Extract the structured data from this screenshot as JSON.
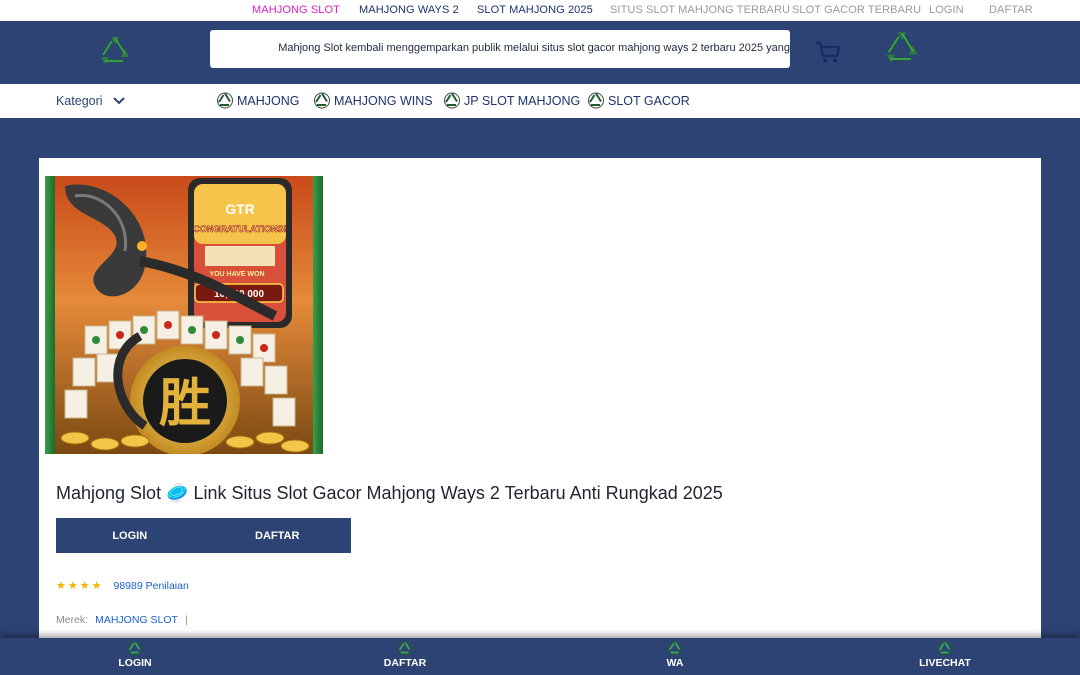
{
  "topbar": {
    "links": [
      {
        "label": "MAHJONG SLOT",
        "color": "#e020c8"
      },
      {
        "label": "MAHJONG WAYS 2",
        "color": "#1e3370"
      },
      {
        "label": "SLOT MAHJONG 2025",
        "color": "#1e3370"
      },
      {
        "label": "SITUS SLOT MAHJONG TERBARU",
        "color": "#9a9a9a"
      },
      {
        "label": "SLOT GACOR TERBARU",
        "color": "#9a9a9a"
      },
      {
        "label": "LOGIN",
        "color": "#9a9a9a"
      },
      {
        "label": "DAFTAR",
        "color": "#9a9a9a"
      }
    ]
  },
  "header": {
    "ticker_text": "Mahjong Slot kembali menggemparkan publik melalui situs slot gacor mahjong ways 2 terbaru 2025 yang",
    "logo_icon": "recycle-icon",
    "cart_icon": "cart-icon"
  },
  "nav": {
    "kategori_label": "Kategori",
    "items": [
      {
        "label": "MAHJONG"
      },
      {
        "label": "MAHJONG WINS"
      },
      {
        "label": "JP SLOT MAHJONG"
      },
      {
        "label": "SLOT GACOR"
      }
    ]
  },
  "product": {
    "image_texts": {
      "brand": "GTR",
      "headline": "CONGRATULATIONS!",
      "sub": "YOU HAVE WON",
      "amount": "10,000,000"
    },
    "title": "Mahjong Slot 🥏 Link Situs Slot Gacor Mahjong Ways 2 Terbaru Anti Rungkad 2025",
    "login_label": "LOGIN",
    "daftar_label": "DAFTAR",
    "stars": 4,
    "rating_count": "98989 Penilaian",
    "brand_label": "Merek:",
    "brand_value": "MAHJONG SLOT",
    "brand_separator": "|"
  },
  "bottom_nav": {
    "items": [
      {
        "label": "LOGIN"
      },
      {
        "label": "DAFTAR"
      },
      {
        "label": "WA"
      },
      {
        "label": "LIVECHAT"
      }
    ]
  },
  "colors": {
    "primary": "#2d4373",
    "accent_pink": "#e020c8",
    "link_blue": "#1a5fd0",
    "star": "#f5b301"
  }
}
